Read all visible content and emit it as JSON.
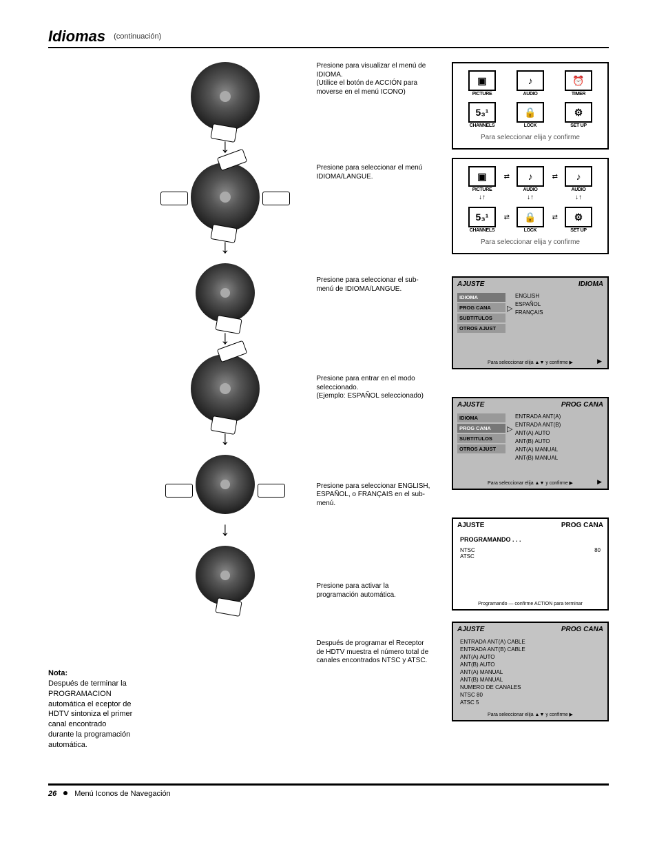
{
  "header": {
    "title": "Idiomas",
    "continued": "(continuación)"
  },
  "steps": {
    "s2": {
      "label": "",
      "left": "Presione para seleccionar el menú IDIOMA/LANGUE.",
      "right_line1": "Presione para visualizar el menú de IDIOMA.",
      "right_line2": "(Utilice el botón de ACCIÓN para moverse en el menú ICONO)"
    },
    "s3": {
      "label": "",
      "right": "Presione para seleccionar el sub-menú de IDIOMA/LANGUE."
    },
    "s4": {
      "label": "",
      "right_line1": "Presione para entrar en el modo seleccionado.",
      "right_line2": "(Ejemplo: ESPAÑOL seleccionado)"
    },
    "s5": {
      "label": "",
      "right": "Presione para seleccionar ENGLISH, ESPAÑOL, o FRANÇAIS en el sub-menú."
    },
    "s6": {
      "label": "",
      "right": "Presione para activar la programación automática."
    }
  },
  "notes": {
    "title": "Nota:",
    "body": "Después de terminar la PROGRAMACION automática el eceptor de HDTV sintoniza el primer canal encontrado durante la programación automática."
  },
  "menu_icons": {
    "picture": "PICTURE",
    "audio": "AUDIO",
    "timer": "TIMER",
    "channels": "CHANNELS",
    "lock": "LOCK",
    "setup": "SET UP",
    "caption1": "Para seleccionar elija y confirme",
    "caption2": "Para seleccionar elija y confirme",
    "ch_glyph": "5₃¹"
  },
  "osd1": {
    "left_title": "AJUSTE",
    "right_title": "IDIOMA",
    "tabs": [
      "IDIOMA",
      "PROG CANA",
      "SUBTITULOS",
      "OTROS AJUST"
    ],
    "active_index": 0,
    "options": [
      "ENGLISH",
      "ESPAÑOL",
      "FRANÇAIS"
    ],
    "footer": "Para seleccionar elija ▲▼ y confirme ▶"
  },
  "osd2": {
    "left_title": "AJUSTE",
    "right_title": "PROG CANA",
    "tabs": [
      "IDIOMA",
      "PROG CANA",
      "SUBTITULOS",
      "OTROS AJUST"
    ],
    "active_index": 1,
    "rows": [
      "ENTRADA ANT(A)",
      "ENTRADA ANT(B)",
      "ANT(A) AUTO",
      "ANT(B) AUTO",
      "ANT(A) MANUAL",
      "ANT(B) MANUAL"
    ],
    "footer": "Para seleccionar elija ▲▼ y confirme ▶"
  },
  "progress_box": {
    "left_title": "AJUSTE",
    "right_title": "PROG CANA",
    "subtitle": "PROGRAMANDO . . . ",
    "rows": [
      {
        "label": "NTSC",
        "value": "80"
      },
      {
        "label": "ATSC",
        "value": ""
      }
    ],
    "footer": "Programando — confirme ACTION para terminar"
  },
  "final_box": {
    "left_title": "AJUSTE",
    "right_title": "PROG CANA",
    "rows": [
      "ENTRADA ANT(A)      CABLE",
      "ENTRADA ANT(B)      CABLE",
      "ANT(A) AUTO",
      "ANT(B) AUTO",
      "ANT(A) MANUAL",
      "ANT(B) MANUAL",
      "",
      "NUMERO DE CANALES",
      "NTSC      80",
      "ATSC       5"
    ],
    "footer": "Para seleccionar elija ▲▼ y confirme ▶"
  },
  "last_paragraph": "Después de programar el Receptor de HDTV muestra el número total de canales encontrados NTSC y ATSC.",
  "page": {
    "number": "26",
    "crumb": "Menú Iconos de Navegación"
  }
}
